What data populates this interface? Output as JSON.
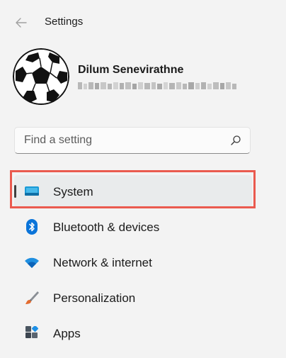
{
  "window": {
    "title": "Settings",
    "back_icon": "back-arrow-icon"
  },
  "profile": {
    "name": "Dilum Senevirathne",
    "avatar_icon": "soccer-ball-avatar"
  },
  "search": {
    "placeholder": "Find a setting",
    "value": "",
    "icon": "search-icon"
  },
  "nav": {
    "items": [
      {
        "label": "System",
        "icon": "system-monitor-icon",
        "active": true
      },
      {
        "label": "Bluetooth & devices",
        "icon": "bluetooth-icon",
        "active": false
      },
      {
        "label": "Network & internet",
        "icon": "wifi-icon",
        "active": false
      },
      {
        "label": "Personalization",
        "icon": "paintbrush-icon",
        "active": false
      },
      {
        "label": "Apps",
        "icon": "apps-icon",
        "active": false
      }
    ]
  },
  "colors": {
    "window_bg": "#f3f3f3",
    "accent_blue": "#0078d4",
    "highlight_red": "#ea5a4f",
    "active_item_bg": "#e9ebec"
  }
}
